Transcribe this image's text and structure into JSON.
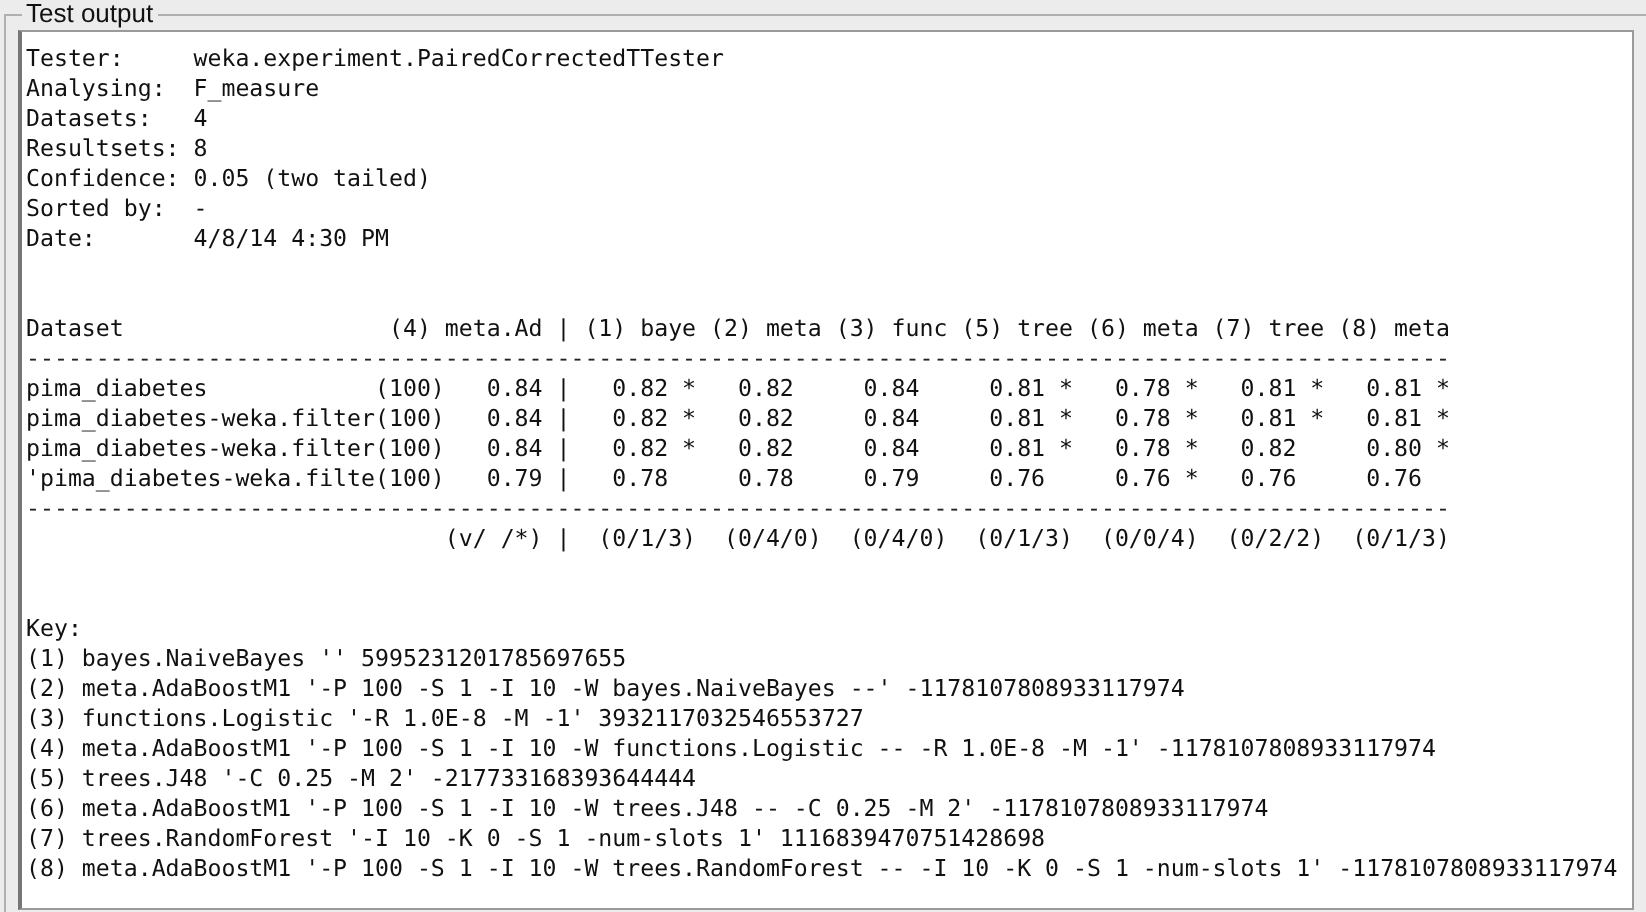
{
  "panel": {
    "title": "Test output"
  },
  "lines": [
    {
      "kind": "text",
      "text": "Tester:     weka.experiment.PairedCorrectedTTester"
    },
    {
      "kind": "text",
      "text": "Analysing:  F_measure"
    },
    {
      "kind": "text",
      "text": "Datasets:   4"
    },
    {
      "kind": "text",
      "text": "Resultsets: 8"
    },
    {
      "kind": "text",
      "text": "Confidence: 0.05 (two tailed)"
    },
    {
      "kind": "text",
      "text": "Sorted by:  -"
    },
    {
      "kind": "text",
      "text": "Date:       4/8/14 4:30 PM"
    },
    {
      "kind": "blank"
    },
    {
      "kind": "blank"
    },
    {
      "kind": "text",
      "text": "Dataset                   (4) meta.Ad | (1) baye (2) meta (3) func (5) tree (6) meta (7) tree (8) meta"
    },
    {
      "kind": "rule",
      "text": "------------------------------------------------------------------------------------------------------"
    },
    {
      "kind": "text",
      "text": "pima_diabetes            (100)   0.84 |   0.82 *   0.82     0.84     0.81 *   0.78 *   0.81 *   0.81 *"
    },
    {
      "kind": "text",
      "text": "pima_diabetes-weka.filter(100)   0.84 |   0.82 *   0.82     0.84     0.81 *   0.78 *   0.81 *   0.81 *"
    },
    {
      "kind": "text",
      "text": "pima_diabetes-weka.filter(100)   0.84 |   0.82 *   0.82     0.84     0.81 *   0.78 *   0.82     0.80 *"
    },
    {
      "kind": "text",
      "text": "'pima_diabetes-weka.filte(100)   0.79 |   0.78     0.78     0.79     0.76     0.76 *   0.76     0.76"
    },
    {
      "kind": "rule",
      "text": "------------------------------------------------------------------------------------------------------"
    },
    {
      "kind": "text",
      "text": "                              (v/ /*) |  (0/1/3)  (0/4/0)  (0/4/0)  (0/1/3)  (0/0/4)  (0/2/2)  (0/1/3)"
    },
    {
      "kind": "blank"
    },
    {
      "kind": "blank"
    },
    {
      "kind": "text",
      "text": "Key:"
    },
    {
      "kind": "text",
      "text": "(1) bayes.NaiveBayes '' 5995231201785697655"
    },
    {
      "kind": "text",
      "text": "(2) meta.AdaBoostM1 '-P 100 -S 1 -I 10 -W bayes.NaiveBayes --' -1178107808933117974"
    },
    {
      "kind": "text",
      "text": "(3) functions.Logistic '-R 1.0E-8 -M -1' 3932117032546553727"
    },
    {
      "kind": "text",
      "text": "(4) meta.AdaBoostM1 '-P 100 -S 1 -I 10 -W functions.Logistic -- -R 1.0E-8 -M -1' -1178107808933117974"
    },
    {
      "kind": "text",
      "text": "(5) trees.J48 '-C 0.25 -M 2' -217733168393644444"
    },
    {
      "kind": "text",
      "text": "(6) meta.AdaBoostM1 '-P 100 -S 1 -I 10 -W trees.J48 -- -C 0.25 -M 2' -1178107808933117974"
    },
    {
      "kind": "text",
      "text": "(7) trees.RandomForest '-I 10 -K 0 -S 1 -num-slots 1' 1116839470751428698"
    },
    {
      "kind": "text",
      "text": "(8) meta.AdaBoostM1 '-P 100 -S 1 -I 10 -W trees.RandomForest -- -I 10 -K 0 -S 1 -num-slots 1' -1178107808933117974"
    }
  ]
}
